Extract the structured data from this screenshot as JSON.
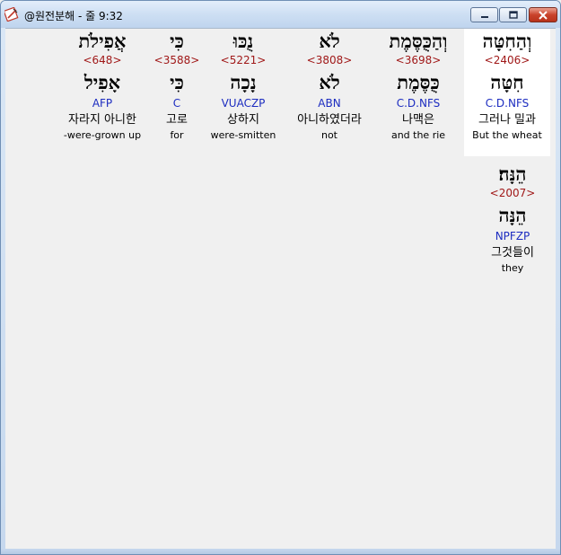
{
  "window": {
    "title": "@원전분해 - 줄 9:32",
    "controls": {
      "minimize": "minimize",
      "maximize": "maximize",
      "close": "close"
    }
  },
  "words": [
    {
      "hebrew": "וְהַחִטָּה",
      "strong": "<2406>",
      "root": "חִטָּה",
      "morph": "C.D.NFS",
      "korean": "그러나 밀과",
      "english": "But the wheat",
      "selected": true
    },
    {
      "hebrew": "וְהַכֻּסֶּמֶת",
      "strong": "<3698>",
      "root": "כֻּסֶּמֶת",
      "morph": "C.D.NFS",
      "korean": "나맥은",
      "english": "and the rie",
      "selected": false
    },
    {
      "hebrew": "לֹא",
      "strong": "<3808>",
      "root": "לֹא",
      "morph": "ABN",
      "korean": "아니하였더라",
      "english": "not",
      "selected": false
    },
    {
      "hebrew": "נֻכּוּ",
      "strong": "<5221>",
      "root": "נָכָה",
      "morph": "VUACZP",
      "korean": "상하지",
      "english": "were-smitten",
      "selected": false
    },
    {
      "hebrew": "כִּי",
      "strong": "<3588>",
      "root": "כִּי",
      "morph": "C",
      "korean": "고로",
      "english": "for",
      "selected": false
    },
    {
      "hebrew": "אֲפִילֹת",
      "strong": "<648>",
      "root": "אָפִיל",
      "morph": "AFP",
      "korean": "자라지 아니한",
      "english": "-were-grown up",
      "selected": false
    },
    {
      "hebrew": "הֵנָּה׃",
      "strong": "<2007>",
      "root": "הֵנָּה",
      "morph": "NPFZP",
      "korean": "그것들이",
      "english": "they",
      "selected": false
    }
  ]
}
